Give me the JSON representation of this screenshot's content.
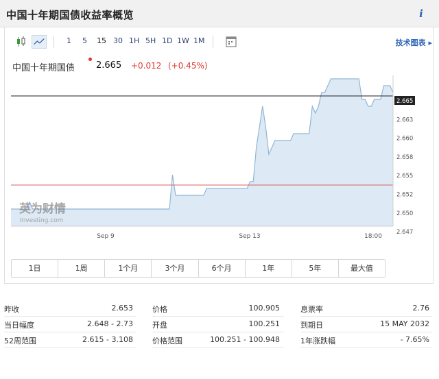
{
  "page": {
    "title": "中国十年期国债收益率概览",
    "info_icon": "info-icon"
  },
  "toolbar": {
    "chart_type_icons": [
      "candlestick-icon",
      "line-chart-icon"
    ],
    "timeframes": [
      "1",
      "5",
      "15",
      "30",
      "1H",
      "5H",
      "1D",
      "1W",
      "1M"
    ],
    "active_timeframe": "15",
    "calendar_icon": "calendar-icon",
    "advanced_chart_label": "技术图表 ▸"
  },
  "quote": {
    "name": "中国十年期国债",
    "last": "2.665",
    "change": "+0.012",
    "change_pct": "(+0.45%)",
    "colors": {
      "up": "#e0352b"
    }
  },
  "watermark": {
    "brand": "英为财情",
    "brand_sub": "Investing.com"
  },
  "range_buttons": [
    "1日",
    "1周",
    "1个月",
    "3个月",
    "6个月",
    "1年",
    "5年",
    "最大值"
  ],
  "stats": {
    "rows": [
      [
        {
          "label": "昨收",
          "value": "2.653"
        },
        {
          "label": "价格",
          "value": "100.905"
        },
        {
          "label": "息票率",
          "value": "2.76"
        }
      ],
      [
        {
          "label": "当日幅度",
          "value": "2.648 - 2.73"
        },
        {
          "label": "开盘",
          "value": "100.251"
        },
        {
          "label": "到期日",
          "value": "15 MAY 2032"
        }
      ],
      [
        {
          "label": "52周范围",
          "value": "2.615 - 3.108"
        },
        {
          "label": "价格范围",
          "value": "100.251 - 100.948"
        },
        {
          "label": "1年涨跌幅",
          "value": "- 7.65%"
        }
      ]
    ]
  },
  "chart_data": {
    "type": "area",
    "title": "",
    "xlabel": "",
    "ylabel": "",
    "x_ticks": [
      "Sep 9",
      "Sep 13",
      "18:00"
    ],
    "y_ticks": [
      "2.665",
      "2.663",
      "2.660",
      "2.658",
      "2.655",
      "2.652",
      "2.650",
      "2.647"
    ],
    "ylim": [
      2.646,
      2.668
    ],
    "series": [
      {
        "values": [
          2.6485,
          2.6485,
          2.6485,
          2.6485,
          2.6485,
          2.6485,
          2.6495,
          2.6485,
          2.6485,
          2.6485,
          2.6485,
          2.6485,
          2.6485,
          2.6485,
          2.6485,
          2.6485,
          2.6485,
          2.6485,
          2.6485,
          2.6485,
          2.6485,
          2.6485,
          2.6485,
          2.6485,
          2.6485,
          2.6485,
          2.6485,
          2.6485,
          2.6485,
          2.6485,
          2.6485,
          2.6485,
          2.6485,
          2.6485,
          2.6485,
          2.6485,
          2.6485,
          2.6485,
          2.6485,
          2.6485,
          2.6485,
          2.6485,
          2.6485,
          2.6485,
          2.6485,
          2.6485,
          2.6485,
          2.6485,
          2.6485,
          2.6485,
          2.6485,
          2.6485,
          2.6535,
          2.6505,
          2.6505,
          2.6505,
          2.6505,
          2.6505,
          2.6505,
          2.6505,
          2.6505,
          2.6505,
          2.6505,
          2.6515,
          2.6515,
          2.6515,
          2.6515,
          2.6515,
          2.6515,
          2.6515,
          2.6515,
          2.6515,
          2.6515,
          2.6515,
          2.6515,
          2.6515,
          2.6515,
          2.6525,
          2.6525,
          2.6575,
          2.6605,
          2.6635,
          2.6605,
          2.6565,
          2.6575,
          2.6585,
          2.6585,
          2.6585,
          2.6585,
          2.6585,
          2.6585,
          2.6595,
          2.6595,
          2.6595,
          2.6595,
          2.6595,
          2.6595,
          2.6635,
          2.6625,
          2.6635,
          2.6655,
          2.6655,
          2.6665,
          2.6675,
          2.6675,
          2.6675,
          2.6675,
          2.6675,
          2.6675,
          2.6675,
          2.6675,
          2.6675,
          2.6675,
          2.6645,
          2.6645,
          2.6635,
          2.6635,
          2.6645,
          2.6645,
          2.6645,
          2.6665,
          2.6665,
          2.6665,
          2.6655
        ]
      }
    ],
    "reference_lines": [
      {
        "value": 2.665,
        "color": "#222222"
      },
      {
        "value": 2.652,
        "color": "#e06060"
      }
    ],
    "grid": false,
    "colors": {
      "line": "#8fb6d8",
      "fill": "#dde9f4"
    }
  }
}
